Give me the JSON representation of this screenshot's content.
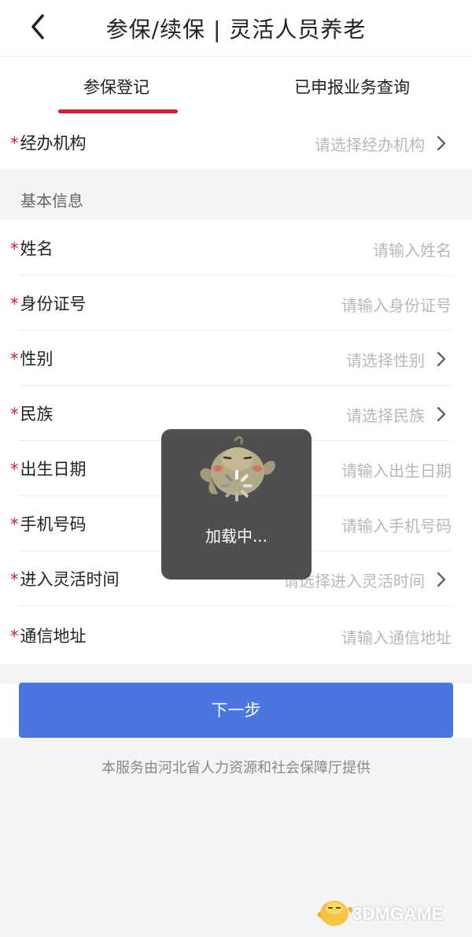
{
  "header": {
    "title": "参保/续保 | 灵活人员养老"
  },
  "tabs": [
    {
      "label": "参保登记",
      "active": true
    },
    {
      "label": "已申报业务查询",
      "active": false
    }
  ],
  "agency": {
    "label": "经办机构",
    "placeholder": "请选择经办机构"
  },
  "section": {
    "title": "基本信息"
  },
  "fields": {
    "name": {
      "label": "姓名",
      "placeholder": "请输入姓名"
    },
    "id_number": {
      "label": "身份证号",
      "placeholder": "请输入身份证号"
    },
    "gender": {
      "label": "性别",
      "placeholder": "请选择性别"
    },
    "ethnicity": {
      "label": "民族",
      "placeholder": "请选择民族"
    },
    "birth_date": {
      "label": "出生日期",
      "placeholder": "请输入出生日期"
    },
    "phone": {
      "label": "手机号码",
      "placeholder": "请输入手机号码"
    },
    "flexible_start": {
      "label": "进入灵活时间",
      "placeholder": "请选择进入灵活时间"
    },
    "address": {
      "label": "通信地址",
      "placeholder": "请输入通信地址"
    }
  },
  "required_mark": "*",
  "next_button": {
    "label": "下一步"
  },
  "provider_note": "本服务由河北省人力资源和社会保障厅提供",
  "loading": {
    "text": "加载中..."
  },
  "watermark": {
    "text": "3DMGAME"
  },
  "colors": {
    "accent_red": "#d71d2b",
    "primary_blue": "#4a76e1",
    "placeholder_gray": "#b8b8b8",
    "background_gray": "#f3f4f6"
  },
  "icons": {
    "back": "chevron-left-icon",
    "row_arrow": "chevron-right-icon",
    "spinner": "spinner-icon",
    "mascot": "mascot-icon"
  }
}
